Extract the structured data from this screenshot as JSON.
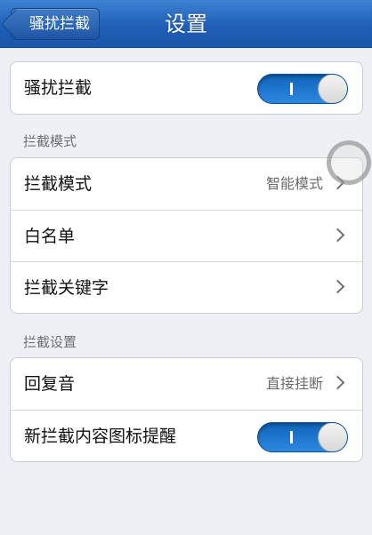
{
  "nav": {
    "back_label": "骚扰拦截",
    "title": "设置"
  },
  "group1": {
    "row1": {
      "label": "骚扰拦截",
      "toggle_on": true
    }
  },
  "section1": {
    "header": "拦截模式"
  },
  "group2": {
    "row1": {
      "label": "拦截模式",
      "value": "智能模式"
    },
    "row2": {
      "label": "白名单"
    },
    "row3": {
      "label": "拦截关键字"
    }
  },
  "section2": {
    "header": "拦截设置"
  },
  "group3": {
    "row1": {
      "label": "回复音",
      "value": "直接挂断"
    },
    "row2": {
      "label": "新拦截内容图标提醒",
      "toggle_on": true
    }
  },
  "colors": {
    "nav_bar": "#1f5fb8",
    "toggle_on": "#2f88e0",
    "page_background": "#eff0f5"
  },
  "icons": {
    "back": "back-arrow-icon",
    "disclosure": "chevron-right-icon"
  }
}
